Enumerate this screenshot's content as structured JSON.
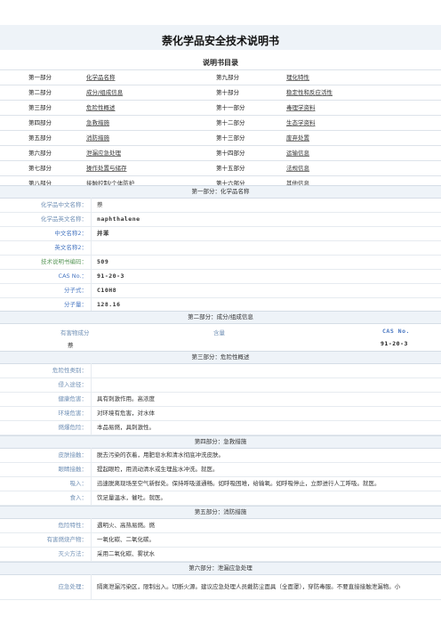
{
  "title": "萘化学品安全技术说明书",
  "toc": {
    "heading": "说明书目录",
    "rows": [
      {
        "p1": "第一部分",
        "n1": "化学品名称",
        "p2": "第九部分",
        "n2": "理化特性"
      },
      {
        "p1": "第二部分",
        "n1": "成分/组成信息",
        "p2": "第十部分",
        "n2": "稳定性和反应活性"
      },
      {
        "p1": "第三部分",
        "n1": "危险性概述",
        "p2": "第十一部分",
        "n2": "毒理学资料"
      },
      {
        "p1": "第四部分",
        "n1": "急救措施",
        "p2": "第十二部分",
        "n2": "生态学资料"
      },
      {
        "p1": "第五部分",
        "n1": "消防措施",
        "p2": "第十三部分",
        "n2": "废弃处置"
      },
      {
        "p1": "第六部分",
        "n1": "泄漏应急处理",
        "p2": "第十四部分",
        "n2": "运输信息"
      },
      {
        "p1": "第七部分",
        "n1": "操作处置与储存",
        "p2": "第十五部分",
        "n2": "法规信息"
      },
      {
        "p1": "第八部分",
        "n1": "接触控制/个体防护",
        "p2": "第十六部分",
        "n2": "其他信息"
      }
    ]
  },
  "s1": {
    "header": "第一部分：化学品名称",
    "rows": [
      {
        "label": "化学品中文名称：",
        "value": "萘"
      },
      {
        "label": "化学品英文名称：",
        "value": "naphthalene"
      },
      {
        "label": "中文名称2：",
        "value": "并苯"
      },
      {
        "label": "英文名称2：",
        "value": ""
      },
      {
        "label": "技术说明书编码：",
        "value": "509"
      },
      {
        "label": "CAS No.：",
        "value": "91-20-3"
      },
      {
        "label": "分子式：",
        "value": "C10H8"
      },
      {
        "label": "分子量：",
        "value": "128.16"
      }
    ]
  },
  "s2": {
    "header": "第二部分：成分/组成信息",
    "col1": "有害物成分",
    "col2": "含量",
    "col3": "CAS No.",
    "name": "萘",
    "cas": "91-20-3"
  },
  "s3": {
    "header": "第三部分：危险性概述",
    "rows": [
      {
        "label": "危险性类别：",
        "value": ""
      },
      {
        "label": "侵入途径：",
        "value": ""
      },
      {
        "label": "健康危害：",
        "value": "具有刺激作用。高浓度"
      },
      {
        "label": "环境危害：",
        "value": "对环境有危害，对水体"
      },
      {
        "label": "燃爆危险：",
        "value": "本品易燃，具刺激性。"
      }
    ]
  },
  "s4": {
    "header": "第四部分：急救措施",
    "rows": [
      {
        "label": "皮肤接触：",
        "value": "脱去污染的衣着，用肥皂水和清水彻底冲洗皮肤。"
      },
      {
        "label": "眼睛接触：",
        "value": "提起眼睑，用流动清水或生理盐水冲洗。就医。"
      },
      {
        "label": "吸入：",
        "value": "迅速脱离现场至空气新鲜处。保持呼吸道通畅。如呼吸困难，给输氧。如呼吸停止，立即进行人工呼吸。就医。"
      },
      {
        "label": "食入：",
        "value": "饮足量温水，催吐。就医。"
      }
    ]
  },
  "s5": {
    "header": "第五部分：消防措施",
    "rows": [
      {
        "label": "危险特性：",
        "value": "遇明火、高热易燃。燃"
      },
      {
        "label": "有害燃烧产物：",
        "value": "一氧化碳、二氧化碳。"
      },
      {
        "label": "灭火方法：",
        "value": "采用二氧化碳、雾状水"
      }
    ]
  },
  "s6": {
    "header": "第六部分：泄漏应急处理",
    "rows": [
      {
        "label": "应急处理：",
        "value": "隔离泄漏污染区，限制出入。切断火源。建议应急处理人员戴防尘面具（全面罩），穿防毒服。不要直接接触泄漏物。小"
      }
    ]
  }
}
